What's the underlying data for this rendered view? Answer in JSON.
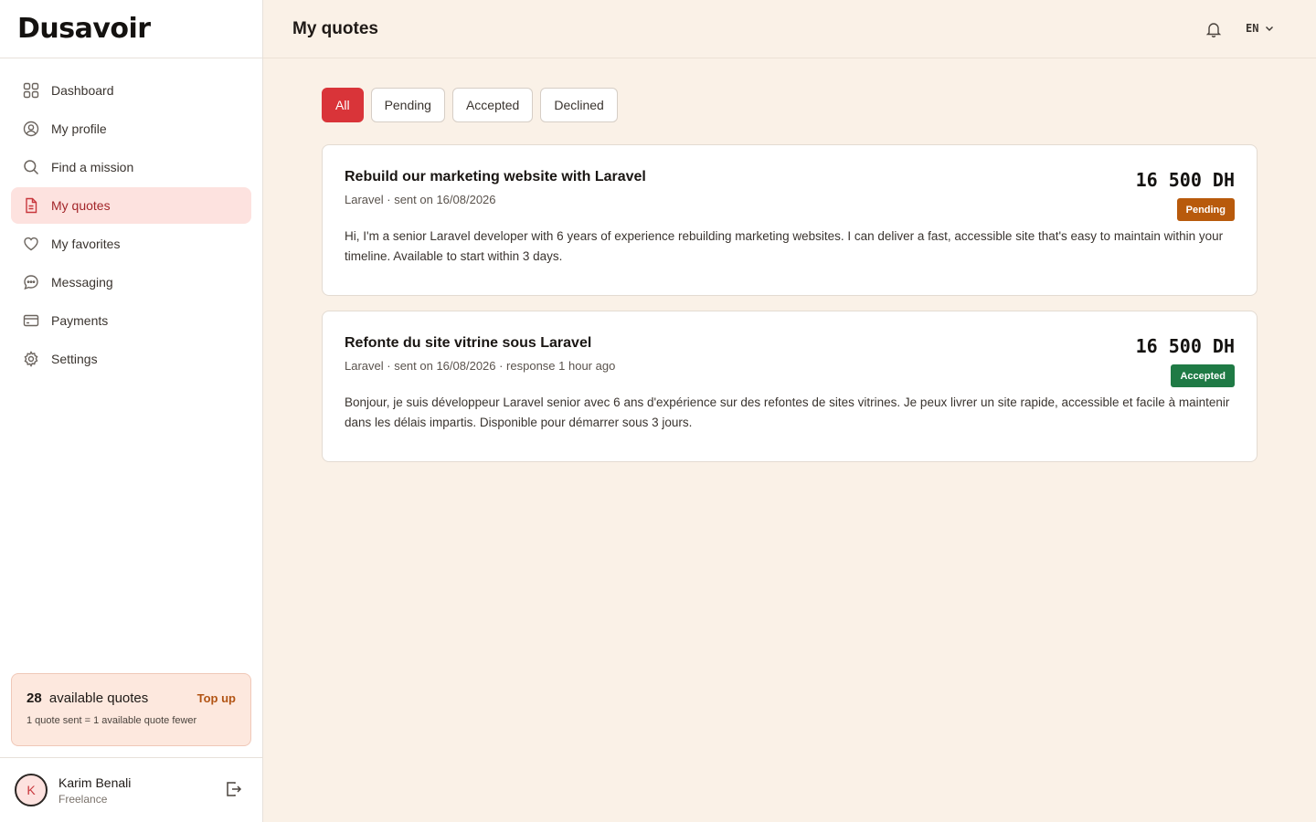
{
  "brand": {
    "name": "Dusavoir"
  },
  "sidebar": {
    "items": [
      {
        "label": "Dashboard",
        "icon": "dashboard-grid-icon"
      },
      {
        "label": "My profile",
        "icon": "user-circle-icon"
      },
      {
        "label": "Find a mission",
        "icon": "search-icon"
      },
      {
        "label": "My quotes",
        "icon": "document-icon",
        "active": true
      },
      {
        "label": "My favorites",
        "icon": "heart-icon"
      },
      {
        "label": "Messaging",
        "icon": "chat-bubble-icon"
      },
      {
        "label": "Payments",
        "icon": "credit-card-icon"
      },
      {
        "label": "Settings",
        "icon": "gear-icon"
      }
    ],
    "credits": {
      "count": "28",
      "label": "available quotes",
      "topup": "Top up",
      "note": "1 quote sent = 1 available quote fewer"
    },
    "user": {
      "initial": "K",
      "name": "Karim Benali",
      "role": "Freelance"
    }
  },
  "header": {
    "title": "My quotes",
    "language": "EN"
  },
  "filters": [
    {
      "label": "All",
      "active": true
    },
    {
      "label": "Pending"
    },
    {
      "label": "Accepted"
    },
    {
      "label": "Declined"
    }
  ],
  "quotes": [
    {
      "title": "Rebuild our marketing website with Laravel",
      "meta": "Laravel · sent on 16/08/2026",
      "amount": "16 500 DH",
      "status": "Pending",
      "status_color": "#b85a0c",
      "description": "Hi, I'm a senior Laravel developer with 6 years of experience rebuilding marketing websites. I can deliver a fast, accessible site that's easy to maintain within your timeline. Available to start within 3 days."
    },
    {
      "title": "Refonte du site vitrine sous Laravel",
      "meta": "Laravel · sent on 16/08/2026 · response 1 hour ago",
      "amount": "16 500 DH",
      "status": "Accepted",
      "status_color": "#1f7a45",
      "description": "Bonjour, je suis développeur Laravel senior avec 6 ans d'expérience sur des refontes de sites vitrines. Je peux livrer un site rapide, accessible et facile à maintenir dans les délais impartis. Disponible pour démarrer sous 3 jours."
    }
  ],
  "colors": {
    "accent": "#d93439",
    "active_nav_bg": "#fde2df",
    "page_bg": "#faf1e7"
  }
}
